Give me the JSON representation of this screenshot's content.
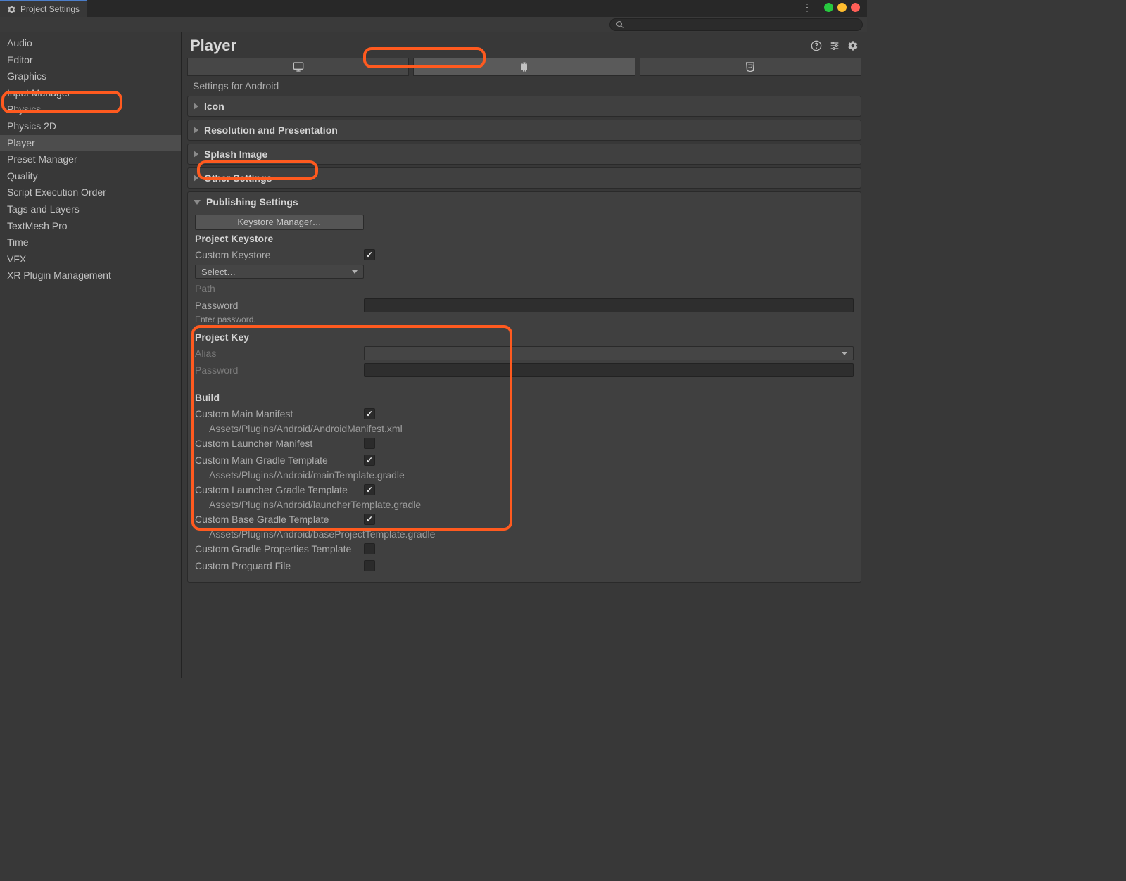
{
  "titlebar": {
    "tab_title": "Project Settings"
  },
  "sidebar": {
    "items": [
      "Audio",
      "Editor",
      "Graphics",
      "Input Manager",
      "Physics",
      "Physics 2D",
      "Player",
      "Preset Manager",
      "Quality",
      "Script Execution Order",
      "Tags and Layers",
      "TextMesh Pro",
      "Time",
      "VFX",
      "XR Plugin Management"
    ],
    "selected": "Player"
  },
  "content": {
    "title": "Player",
    "settings_for": "Settings for Android",
    "platform_tabs": [
      "standalone",
      "android",
      "webgl"
    ],
    "active_platform": "android",
    "sections": {
      "icon": {
        "label": "Icon",
        "expanded": false
      },
      "resolution": {
        "label": "Resolution and Presentation",
        "expanded": false
      },
      "splash": {
        "label": "Splash Image",
        "expanded": false
      },
      "other": {
        "label": "Other Settings",
        "expanded": false
      },
      "publishing": {
        "label": "Publishing Settings",
        "expanded": true,
        "keystore_button": "Keystore Manager…",
        "project_keystore": {
          "header": "Project Keystore",
          "custom_keystore_label": "Custom Keystore",
          "custom_keystore_checked": true,
          "select_label": "Select…",
          "path_label": "Path",
          "path_value": "",
          "password_label": "Password",
          "password_value": "",
          "password_hint": "Enter password."
        },
        "project_key": {
          "header": "Project Key",
          "alias_label": "Alias",
          "alias_value": "",
          "password_label": "Password",
          "password_value": ""
        },
        "build": {
          "header": "Build",
          "items": [
            {
              "label": "Custom Main Manifest",
              "checked": true,
              "path": "Assets/Plugins/Android/AndroidManifest.xml"
            },
            {
              "label": "Custom Launcher Manifest",
              "checked": false
            },
            {
              "label": "Custom Main Gradle Template",
              "checked": true,
              "path": "Assets/Plugins/Android/mainTemplate.gradle"
            },
            {
              "label": "Custom Launcher Gradle Template",
              "checked": true,
              "path": "Assets/Plugins/Android/launcherTemplate.gradle"
            },
            {
              "label": "Custom Base Gradle Template",
              "checked": true,
              "path": "Assets/Plugins/Android/baseProjectTemplate.gradle"
            },
            {
              "label": "Custom Gradle Properties Template",
              "checked": false
            },
            {
              "label": "Custom Proguard File",
              "checked": false
            }
          ]
        }
      }
    }
  }
}
